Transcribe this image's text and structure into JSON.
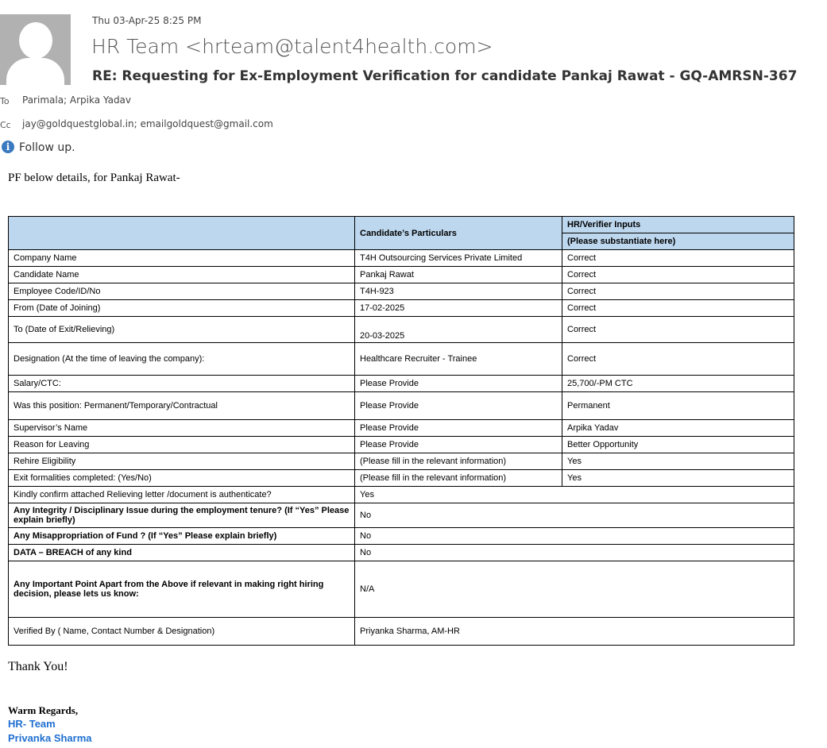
{
  "header": {
    "date": "Thu 03-Apr-25 8:25 PM",
    "from": "HR Team <hrteam@talent4health.com>",
    "subject": "RE: Requesting for Ex-Employment Verification for candidate  Pankaj Rawat - GQ-AMRSN-367",
    "to_label": "To",
    "to": "Parimala; Arpika Yadav",
    "cc_label": "Cc",
    "cc": "jay@goldquestglobal.in; emailgoldquest@gmail.com",
    "flag": "Follow up."
  },
  "body": {
    "intro": "PF below details, for Pankaj Rawat-",
    "thanks": "Thank You!",
    "regards": "Warm Regards,",
    "sig1": "HR- Team",
    "sig2": "Privanka Sharma"
  },
  "table": {
    "h_particulars": "Candidate’s Particulars",
    "h_verifier": "HR/Verifier Inputs",
    "h_sub": "(Please substantiate here)",
    "rows": [
      [
        "Company Name",
        "T4H Outsourcing Services Private Limited",
        "Correct"
      ],
      [
        "Candidate Name",
        "Pankaj Rawat",
        "Correct"
      ],
      [
        "Employee Code/ID/No",
        "T4H-923",
        "Correct"
      ],
      [
        "From (Date of Joining)",
        "17-02-2025",
        "Correct"
      ],
      [
        "To (Date of Exit/Relieving)",
        "20-03-2025",
        "Correct"
      ],
      [
        "Designation (At the time of leaving the company):",
        "Healthcare Recruiter - Trainee",
        "Correct"
      ],
      [
        "Salary/CTC:",
        "Please Provide",
        " 25,700/-PM CTC"
      ],
      [
        "Was this position: Permanent/Temporary/Contractual",
        "Please Provide",
        "Permanent"
      ],
      [
        "Supervisor’s Name",
        "Please Provide",
        "Arpika Yadav"
      ],
      [
        "Reason for Leaving",
        "Please Provide",
        "Better Opportunity"
      ],
      [
        "Rehire Eligibility",
        "(Please fill in the relevant information)",
        "Yes"
      ],
      [
        "Exit formalities completed: (Yes/No)",
        "(Please fill in the relevant information)",
        "Yes"
      ]
    ],
    "merged": [
      [
        "Kindly confirm attached Relieving letter /document is authenticate?",
        "Yes"
      ],
      [
        "Any Integrity / Disciplinary Issue during the employment tenure? (If “Yes” Please explain briefly)",
        "No"
      ],
      [
        "Any Misappropriation of Fund ? (If “Yes” Please explain briefly)",
        "No"
      ],
      [
        "DATA – BREACH of any kind",
        "No"
      ],
      [
        "Any Important Point Apart from the Above if relevant in making right hiring decision, please lets us know:",
        "N/A"
      ],
      [
        "Verified By ( Name, Contact Number & Designation)",
        "Priyanka Sharma, AM-HR"
      ]
    ]
  }
}
